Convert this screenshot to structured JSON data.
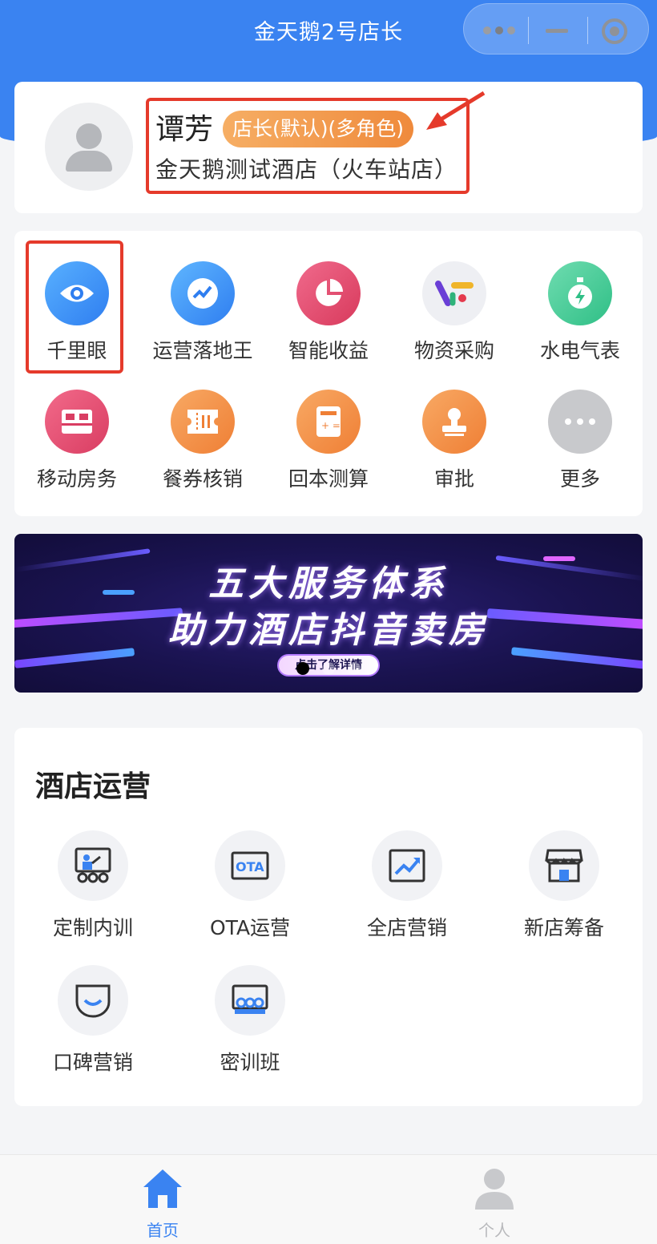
{
  "app": {
    "title": "金天鹅2号店长"
  },
  "profile": {
    "name": "谭芳",
    "role": "店长(默认)(多角色)",
    "hotel": "金天鹅测试酒店（火车站店）"
  },
  "quick_menu": [
    {
      "label": "千里眼",
      "icon": "eye-icon"
    },
    {
      "label": "运营落地王",
      "icon": "trend-icon"
    },
    {
      "label": "智能收益",
      "icon": "pie-chart-icon"
    },
    {
      "label": "物资采购",
      "icon": "procurement-logo-icon"
    },
    {
      "label": "水电气表",
      "icon": "meter-icon"
    },
    {
      "label": "移动房务",
      "icon": "bed-icon"
    },
    {
      "label": "餐券核销",
      "icon": "meal-ticket-icon"
    },
    {
      "label": "回本测算",
      "icon": "calculator-icon"
    },
    {
      "label": "审批",
      "icon": "stamp-icon"
    },
    {
      "label": "更多",
      "icon": "more-dots-icon"
    }
  ],
  "banner": {
    "line1": "五大服务体系",
    "line2": "助力酒店抖音卖房",
    "cta": "点击了解详情",
    "slide_count": 3,
    "active_slide": 1
  },
  "ops": {
    "title": "酒店运营",
    "items": [
      {
        "label": "定制内训",
        "icon": "training-icon"
      },
      {
        "label": "OTA运营",
        "icon": "ota-icon"
      },
      {
        "label": "全店营销",
        "icon": "marketing-chart-icon"
      },
      {
        "label": "新店筹备",
        "icon": "store-icon"
      },
      {
        "label": "口碑营销",
        "icon": "smile-icon"
      },
      {
        "label": "密训班",
        "icon": "classroom-icon"
      }
    ]
  },
  "tabbar": {
    "home": "首页",
    "profile": "个人"
  },
  "colors": {
    "primary": "#3a83f1",
    "highlight": "#e53a2b",
    "badge": "#ef8a3c"
  }
}
